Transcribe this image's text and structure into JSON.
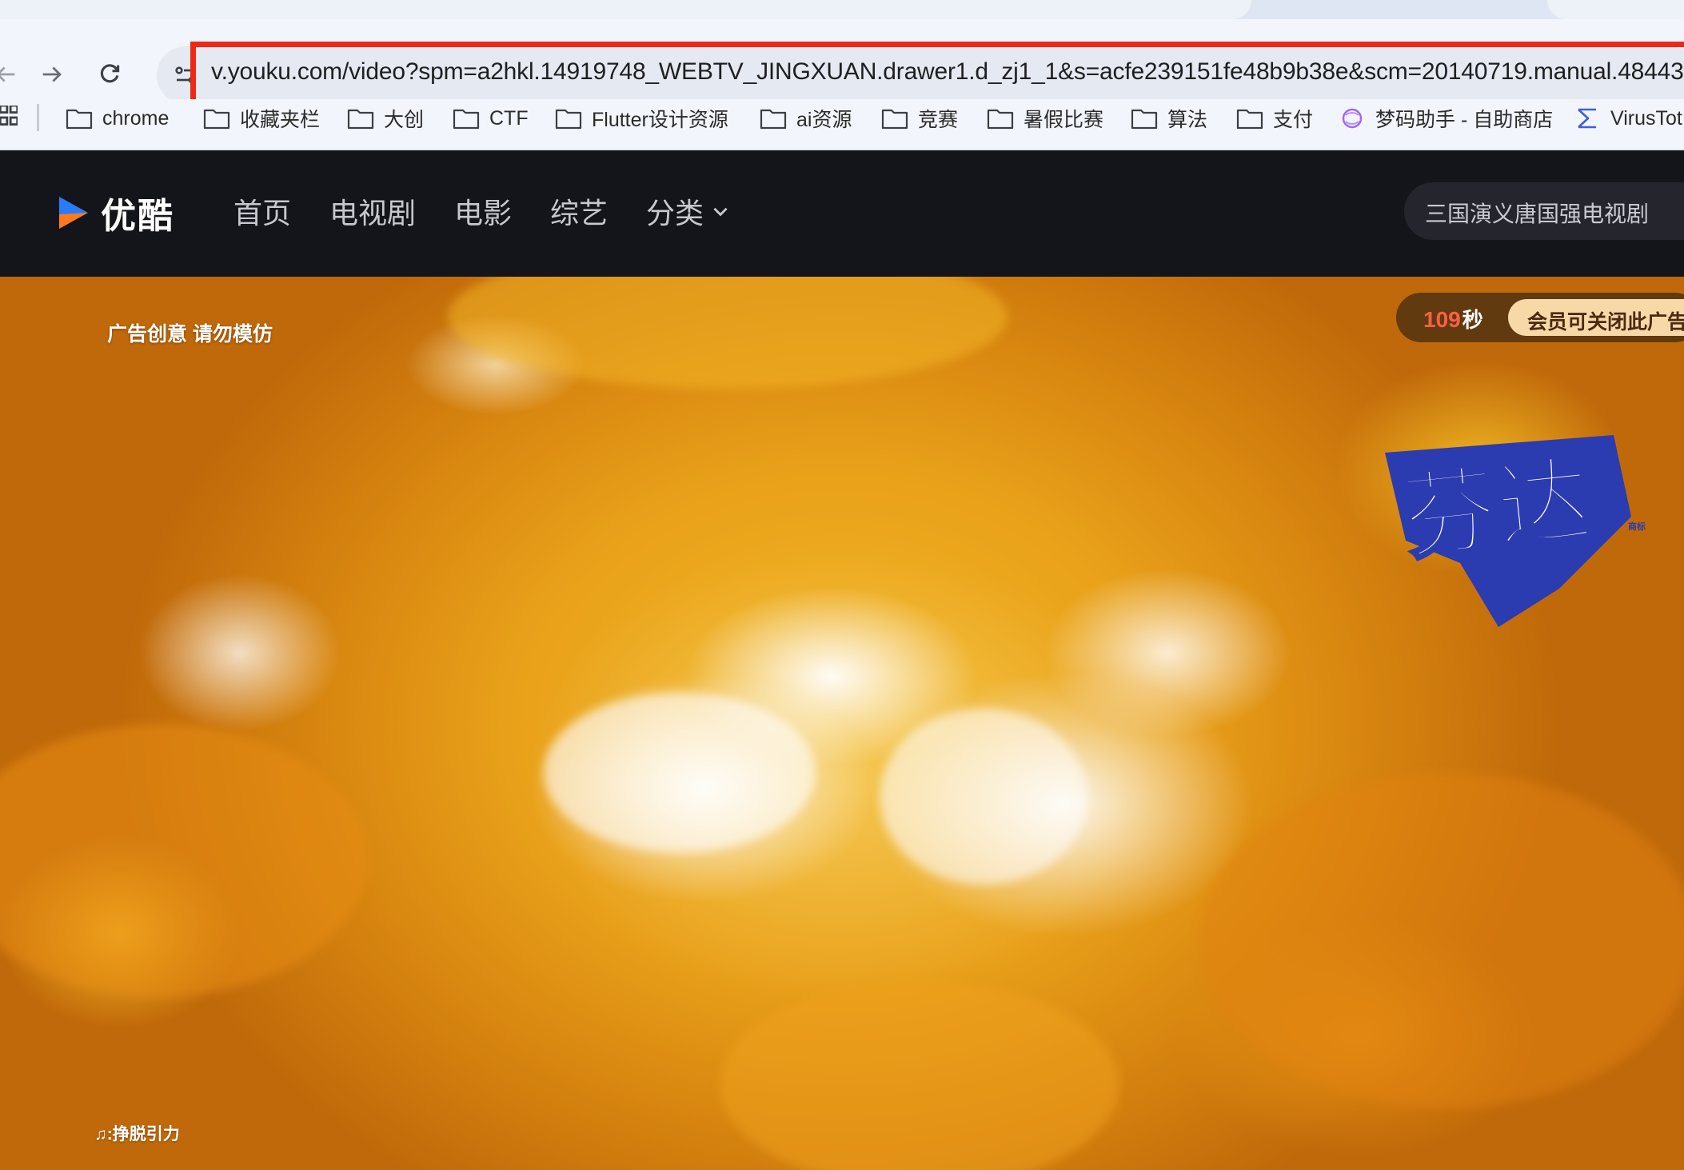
{
  "browser": {
    "omnibox": {
      "url": "v.youku.com/video?spm=a2hkl.14919748_WEBTV_JINGXUAN.drawer1.d_zj1_1&s=acfe239151fe48b9b38e&scm=20140719.manual.48443."
    },
    "bookmarks": [
      {
        "label": "chrome",
        "icon": "folder-icon"
      },
      {
        "label": "收藏夹栏",
        "icon": "folder-icon"
      },
      {
        "label": "大创",
        "icon": "folder-icon"
      },
      {
        "label": "CTF",
        "icon": "folder-icon"
      },
      {
        "label": "Flutter设计资源",
        "icon": "folder-icon"
      },
      {
        "label": "ai资源",
        "icon": "folder-icon"
      },
      {
        "label": "竞赛",
        "icon": "folder-icon"
      },
      {
        "label": "暑假比赛",
        "icon": "folder-icon"
      },
      {
        "label": "算法",
        "icon": "folder-icon"
      },
      {
        "label": "支付",
        "icon": "folder-icon"
      },
      {
        "label": "梦码助手 - 自助商店",
        "icon": "site-favicon-icon"
      },
      {
        "label": "VirusTot",
        "icon": "virustotal-icon"
      }
    ],
    "highlight_color": "#f02617"
  },
  "youku": {
    "logo_text": "优酷",
    "nav": [
      "首页",
      "电视剧",
      "电影",
      "综艺",
      "分类"
    ],
    "search_placeholder": "三国演义唐国强电视剧",
    "brand_colors": {
      "header_bg": "#14151a",
      "logo_blue": "#2a7bf6",
      "logo_orange": "#ff7a1a"
    }
  },
  "ad": {
    "notice": "广告创意 请勿模仿",
    "countdown": "109",
    "countdown_unit": "秒",
    "vip_close": "会员可关闭此广告",
    "brand_name": "芬达",
    "brand_trademark": "商标",
    "music": "♫:挣脱引力"
  }
}
